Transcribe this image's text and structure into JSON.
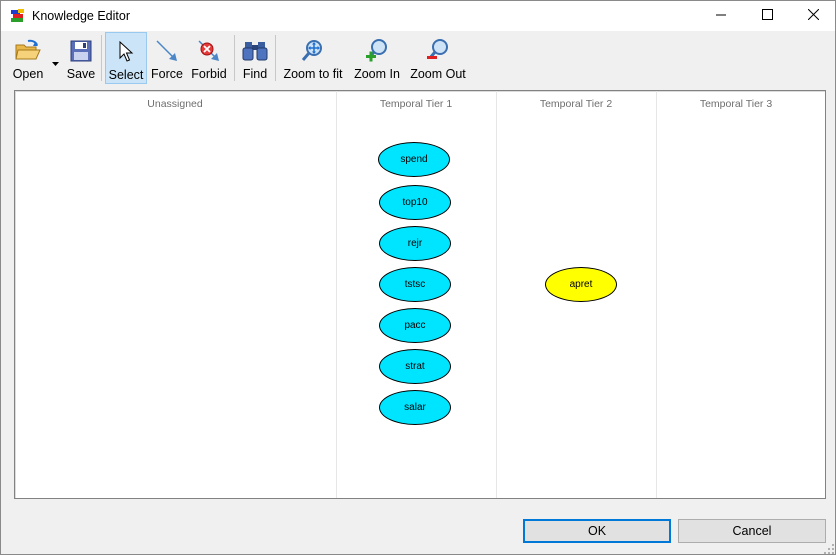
{
  "window": {
    "title": "Knowledge Editor"
  },
  "toolbar": {
    "open_label": "Open",
    "save_label": "Save",
    "select_label": "Select",
    "force_label": "Force",
    "forbid_label": "Forbid",
    "find_label": "Find",
    "zoom_fit_label": "Zoom to fit",
    "zoom_in_label": "Zoom In",
    "zoom_out_label": "Zoom Out",
    "active_tool": "Select"
  },
  "tiers": {
    "unassigned": "Unassigned",
    "tier1": "Temporal Tier 1",
    "tier2": "Temporal Tier 2",
    "tier3": "Temporal Tier 3"
  },
  "nodes": {
    "spend": "spend",
    "top10": "top10",
    "rejr": "rejr",
    "tstsc": "tstsc",
    "pacc": "pacc",
    "strat": "strat",
    "salar": "salar",
    "apret": "apret"
  },
  "node_colors": {
    "tier1": "#00e5ff",
    "tier2": "#ffff00"
  },
  "buttons": {
    "ok": "OK",
    "cancel": "Cancel"
  }
}
